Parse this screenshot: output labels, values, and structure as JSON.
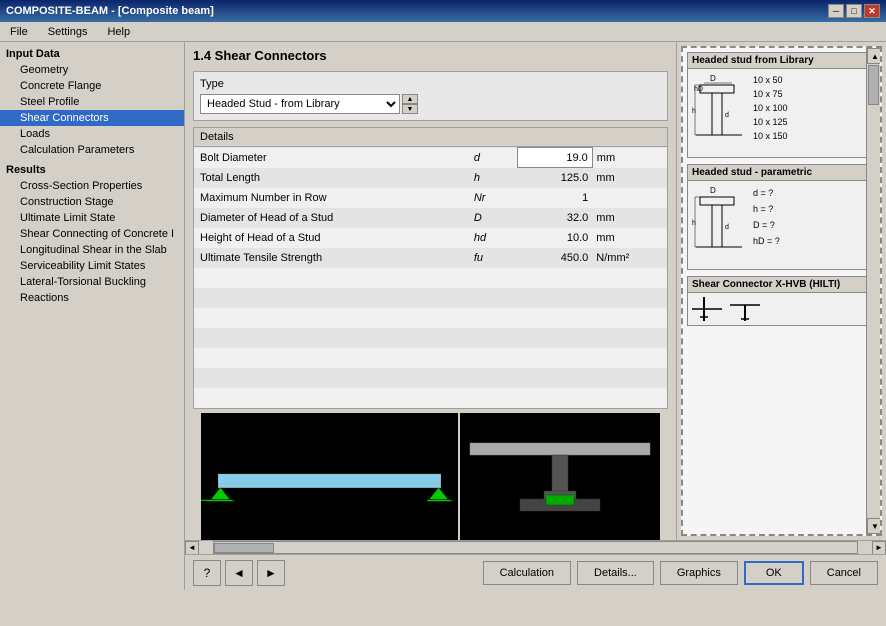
{
  "titleBar": {
    "title": "COMPOSITE-BEAM - [Composite beam]",
    "buttons": [
      "minimize",
      "maximize",
      "close"
    ]
  },
  "menuBar": {
    "items": [
      "File",
      "Settings",
      "Help"
    ]
  },
  "sidebar": {
    "inputDataLabel": "Input Data",
    "items": [
      {
        "id": "geometry",
        "label": "Geometry"
      },
      {
        "id": "concrete-flange",
        "label": "Concrete Flange"
      },
      {
        "id": "steel-profile",
        "label": "Steel Profile"
      },
      {
        "id": "shear-connectors",
        "label": "Shear Connectors",
        "active": true
      },
      {
        "id": "loads",
        "label": "Loads"
      },
      {
        "id": "calc-params",
        "label": "Calculation Parameters"
      }
    ],
    "resultsLabel": "Results",
    "resultItems": [
      {
        "id": "cross-section",
        "label": "Cross-Section Properties"
      },
      {
        "id": "construction-stage",
        "label": "Construction Stage"
      },
      {
        "id": "ultimate-limit",
        "label": "Ultimate Limit State"
      },
      {
        "id": "shear-connecting",
        "label": "Shear Connecting of Concrete I"
      },
      {
        "id": "longitudinal-shear",
        "label": "Longitudinal Shear in the Slab"
      },
      {
        "id": "serviceability",
        "label": "Serviceability Limit States"
      },
      {
        "id": "lateral-torsional",
        "label": "Lateral-Torsional Buckling"
      },
      {
        "id": "reactions",
        "label": "Reactions"
      }
    ]
  },
  "main": {
    "title": "1.4 Shear Connectors",
    "typeSection": {
      "label": "Type",
      "selectedValue": "Headed Stud - from Library",
      "options": [
        "Headed Stud - from Library",
        "Headed Stud - parametric",
        "Shear Connector X-HVB (HILTI)"
      ]
    },
    "detailsSection": {
      "label": "Details",
      "rows": [
        {
          "name": "Bolt Diameter",
          "symbol": "d",
          "value": "19.0",
          "unit": "mm",
          "highlighted": true
        },
        {
          "name": "Total Length",
          "symbol": "h",
          "value": "125.0",
          "unit": "mm",
          "highlighted": false
        },
        {
          "name": "Maximum Number in Row",
          "symbol": "Nr",
          "value": "1",
          "unit": "",
          "highlighted": false
        },
        {
          "name": "Diameter of Head of a Stud",
          "symbol": "D",
          "value": "32.0",
          "unit": "mm",
          "highlighted": false
        },
        {
          "name": "Height of Head of a Stud",
          "symbol": "hd",
          "value": "10.0",
          "unit": "mm",
          "highlighted": false
        },
        {
          "name": "Ultimate Tensile Strength",
          "symbol": "fu",
          "value": "450.0",
          "unit": "N/mm²",
          "highlighted": false
        }
      ]
    }
  },
  "rightPanel": {
    "library": {
      "title": "Headed stud from Library",
      "sizes": [
        "10 x 50",
        "10 x 75",
        "10 x 100",
        "10 x 125",
        "10 x 150"
      ]
    },
    "parametric": {
      "title": "Headed stud - parametric",
      "params": [
        "d = ?",
        "h = ?",
        "D = ?",
        "hD = ?"
      ]
    },
    "xhvb": {
      "title": "Shear Connector X-HVB (HILTI)"
    }
  },
  "buttons": {
    "calculation": "Calculation",
    "details": "Details...",
    "graphics": "Graphics",
    "ok": "OK",
    "cancel": "Cancel"
  },
  "icons": {
    "help": "?",
    "back": "◄",
    "forward": "►",
    "scrollUp": "▲",
    "scrollDown": "▼",
    "scrollLeft": "◄",
    "scrollRight": "►"
  }
}
